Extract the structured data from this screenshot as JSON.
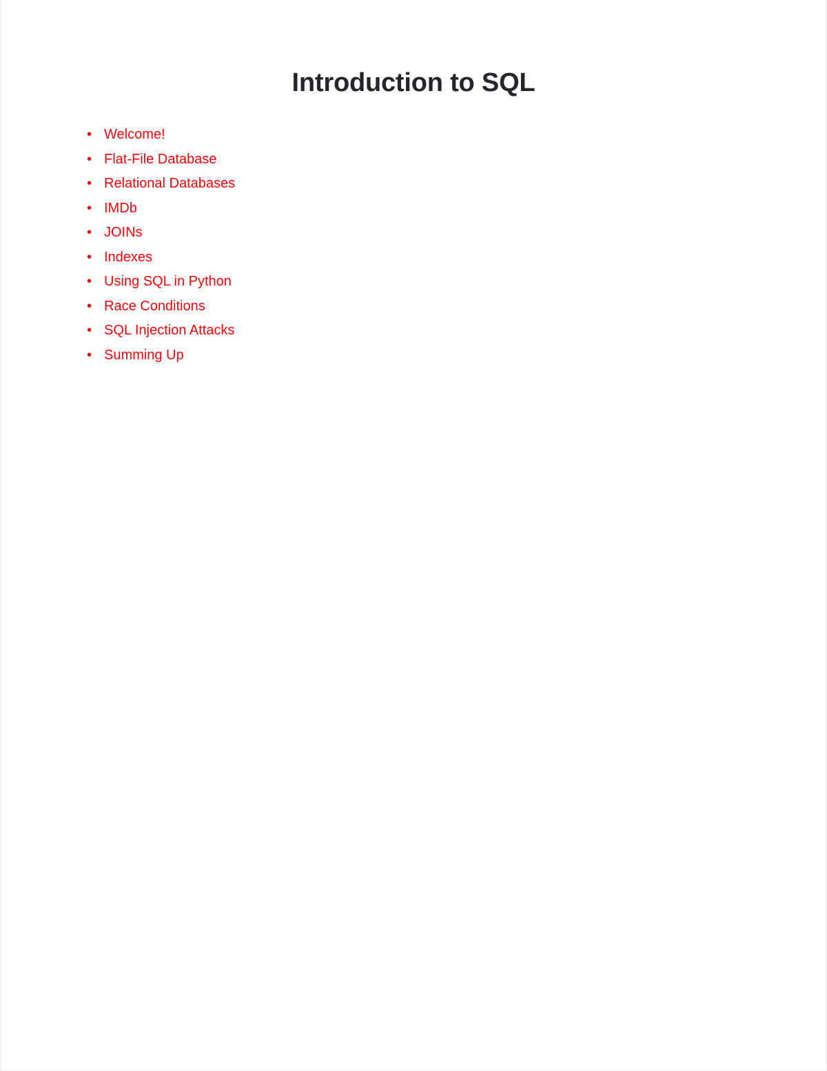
{
  "page": {
    "background_color": "#ffffff",
    "title": "Introduction to SQL",
    "title_color": "#24262b"
  },
  "agenda": {
    "bullet_glyph": "•",
    "text_color": "#fb0307",
    "items": [
      {
        "label": "Welcome!"
      },
      {
        "label": "Flat-File Database"
      },
      {
        "label": "Relational Databases"
      },
      {
        "label": "IMDb"
      },
      {
        "label": "JOINs"
      },
      {
        "label": "Indexes"
      },
      {
        "label": "Using SQL in Python"
      },
      {
        "label": "Race Conditions"
      },
      {
        "label": "SQL Injection Attacks"
      },
      {
        "label": "Summing Up"
      }
    ]
  }
}
